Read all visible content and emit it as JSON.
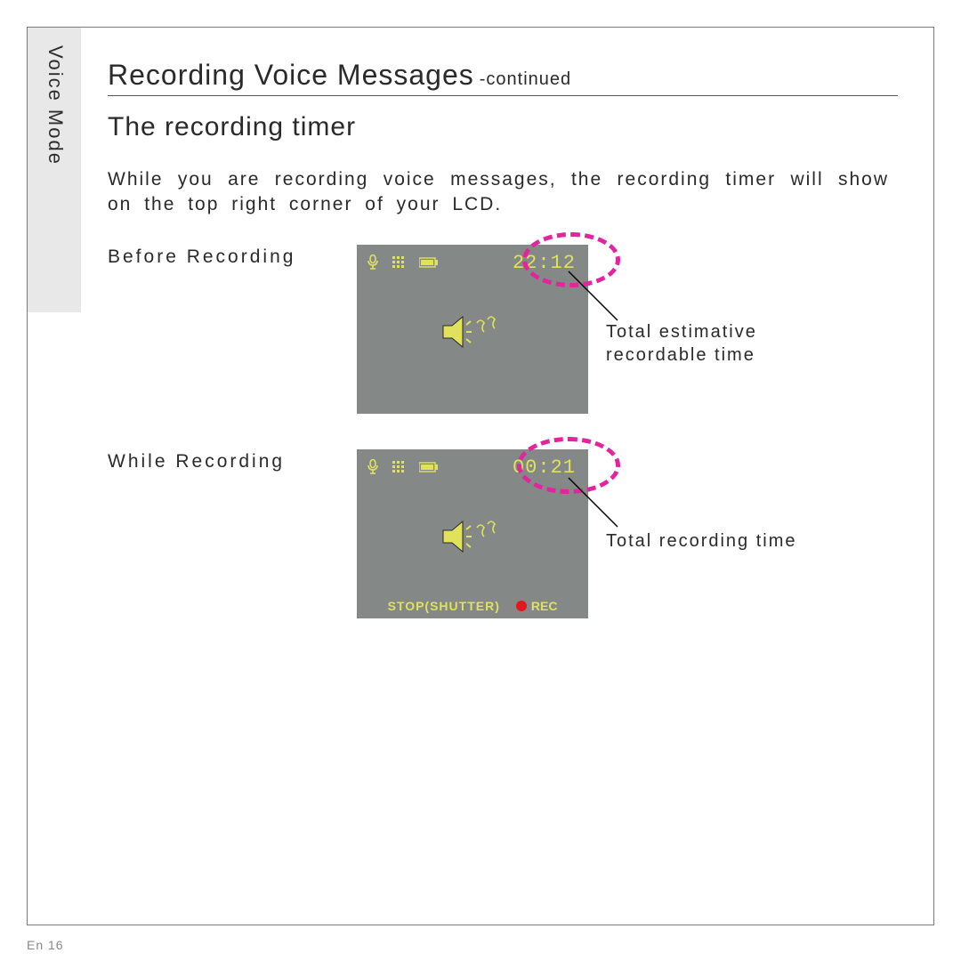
{
  "sidebar": {
    "label": "Voice Mode"
  },
  "heading": {
    "title": "Recording Voice Messages",
    "continued": "-continued"
  },
  "subheading": "The recording timer",
  "paragraph": "While you are recording voice messages, the recording timer will show on the top right corner of your LCD.",
  "fig1": {
    "label": "Before Recording",
    "timer": "22:12",
    "callout": "Total estimative recordable time"
  },
  "fig2": {
    "label": "While Recording",
    "timer": "00:21",
    "stop_text": "STOP(SHUTTER)",
    "rec_text": "REC",
    "callout": "Total recording time"
  },
  "page_number": "En 16"
}
